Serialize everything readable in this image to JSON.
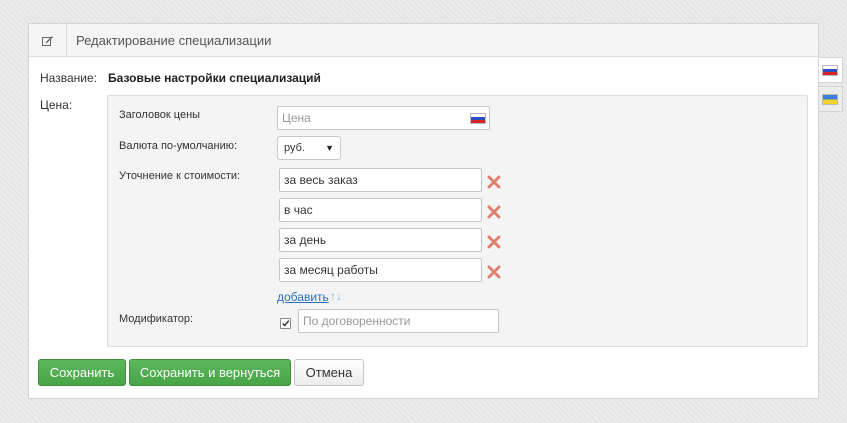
{
  "header": {
    "title": "Редактирование специализации",
    "icon": "edit-icon"
  },
  "form": {
    "name_label": "Название:",
    "name_value": "Базовые настройки специализаций",
    "price_label": "Цена:"
  },
  "price": {
    "title_label": "Заголовок цены",
    "title_placeholder": "Цена",
    "currency_label": "Валюта по-умолчанию:",
    "currency_value": "руб.",
    "clarification_label": "Уточнение к стоимости:",
    "clarifications": [
      "за весь заказ",
      "в час",
      "за день",
      "за месяц работы"
    ],
    "add_label": "добавить",
    "modifier_label": "Модификатор:",
    "modifier_checked": true,
    "modifier_placeholder": "По договоренности"
  },
  "buttons": {
    "save": "Сохранить",
    "save_return": "Сохранить и вернуться",
    "cancel": "Отмена"
  },
  "languages": [
    {
      "code": "ru",
      "icon": "russia-flag-icon",
      "active": true
    },
    {
      "code": "ua",
      "icon": "ukraine-flag-icon",
      "active": false
    }
  ],
  "colors": {
    "primary_button": "#5cb85c",
    "link": "#2a6fbd",
    "remove_icon": "#e08070"
  }
}
